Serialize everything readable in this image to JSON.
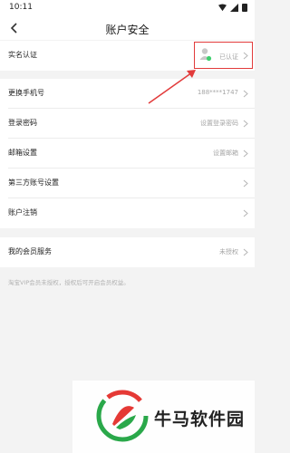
{
  "status_bar": {
    "time": "10:11"
  },
  "header": {
    "title": "账户安全"
  },
  "rows": [
    {
      "label": "实名认证",
      "value": "已认证"
    },
    {
      "label": "更换手机号",
      "value": "188****1747"
    },
    {
      "label": "登录密码",
      "value": "设置登录密码"
    },
    {
      "label": "邮箱设置",
      "value": "设置邮箱"
    },
    {
      "label": "第三方账号设置",
      "value": ""
    },
    {
      "label": "账户注销",
      "value": ""
    },
    {
      "label": "我的会员服务",
      "value": "未授权"
    }
  ],
  "note": "淘宝VIP会员未授权，授权后可开启会员权益。",
  "watermark": {
    "text": "牛马软件园"
  },
  "colors": {
    "highlight": "#e23b3b",
    "verified_dot": "#3ecf6e",
    "logo_green": "#2aa84a",
    "logo_red": "#e53935"
  }
}
